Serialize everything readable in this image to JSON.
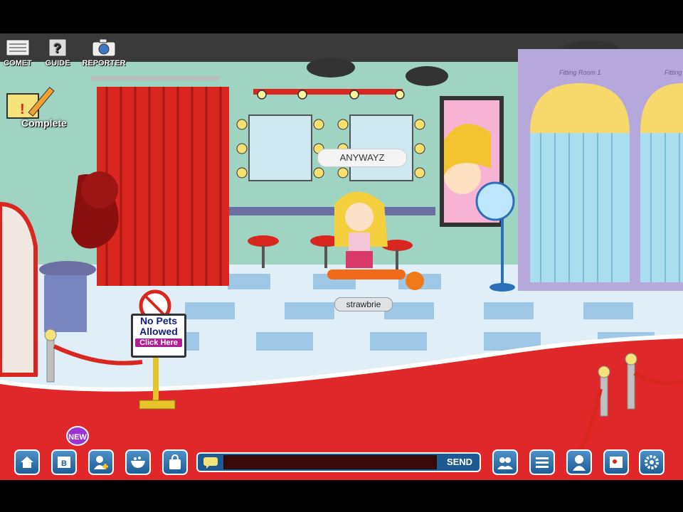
{
  "topbar": {
    "comet_label": "COMET",
    "guide_label": "GUIDE",
    "reporter_label": "REPORTER"
  },
  "quest": {
    "complete_label": "Complete"
  },
  "chat_bubble": "ANYWAYZ",
  "player": {
    "name": "strawbrie"
  },
  "sign": {
    "line1": "No Pets",
    "line2": "Allowed",
    "link": "Click Here"
  },
  "fitting_room": {
    "label": "Fitting Room 1",
    "label2": "Fitting"
  },
  "toolbar": {
    "new_badge": "NEW",
    "send_label": "SEND",
    "chat_value": "",
    "icons": [
      "home-icon",
      "notebook-icon",
      "friend-add-icon",
      "bowl-icon",
      "bag-icon",
      "chat-icon",
      "friends-icon",
      "list-icon",
      "profile-icon",
      "map-icon",
      "settings-icon"
    ]
  },
  "colors": {
    "carpet": "#e0282a",
    "wall": "#9fd3c2",
    "curtain": "#d9261f",
    "ui_blue": "#1f5d96"
  }
}
